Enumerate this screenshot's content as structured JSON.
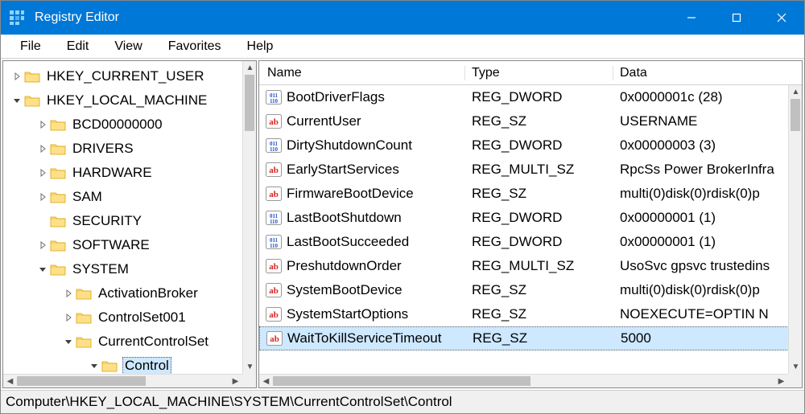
{
  "window": {
    "title": "Registry Editor"
  },
  "menu": {
    "items": [
      "File",
      "Edit",
      "View",
      "Favorites",
      "Help"
    ]
  },
  "tree": {
    "rows": [
      {
        "indent": 0,
        "expander": "closed",
        "label": "HKEY_CURRENT_USER",
        "selected": false
      },
      {
        "indent": 0,
        "expander": "open",
        "label": "HKEY_LOCAL_MACHINE",
        "selected": false
      },
      {
        "indent": 1,
        "expander": "closed",
        "label": "BCD00000000",
        "selected": false
      },
      {
        "indent": 1,
        "expander": "closed",
        "label": "DRIVERS",
        "selected": false
      },
      {
        "indent": 1,
        "expander": "closed",
        "label": "HARDWARE",
        "selected": false
      },
      {
        "indent": 1,
        "expander": "closed",
        "label": "SAM",
        "selected": false
      },
      {
        "indent": 1,
        "expander": "none",
        "label": "SECURITY",
        "selected": false
      },
      {
        "indent": 1,
        "expander": "closed",
        "label": "SOFTWARE",
        "selected": false
      },
      {
        "indent": 1,
        "expander": "open",
        "label": "SYSTEM",
        "selected": false
      },
      {
        "indent": 2,
        "expander": "closed",
        "label": "ActivationBroker",
        "selected": false
      },
      {
        "indent": 2,
        "expander": "closed",
        "label": "ControlSet001",
        "selected": false
      },
      {
        "indent": 2,
        "expander": "open",
        "label": "CurrentControlSet",
        "selected": false
      },
      {
        "indent": 3,
        "expander": "open",
        "label": "Control",
        "selected": true
      }
    ]
  },
  "list": {
    "headers": {
      "name": "Name",
      "type": "Type",
      "data": "Data"
    },
    "rows": [
      {
        "kind": "dword",
        "name": "BootDriverFlags",
        "type": "REG_DWORD",
        "data": "0x0000001c (28)",
        "selected": false
      },
      {
        "kind": "sz",
        "name": "CurrentUser",
        "type": "REG_SZ",
        "data": "USERNAME",
        "selected": false
      },
      {
        "kind": "dword",
        "name": "DirtyShutdownCount",
        "type": "REG_DWORD",
        "data": "0x00000003 (3)",
        "selected": false
      },
      {
        "kind": "sz",
        "name": "EarlyStartServices",
        "type": "REG_MULTI_SZ",
        "data": "RpcSs Power BrokerInfra",
        "selected": false
      },
      {
        "kind": "sz",
        "name": "FirmwareBootDevice",
        "type": "REG_SZ",
        "data": "multi(0)disk(0)rdisk(0)p",
        "selected": false
      },
      {
        "kind": "dword",
        "name": "LastBootShutdown",
        "type": "REG_DWORD",
        "data": "0x00000001 (1)",
        "selected": false
      },
      {
        "kind": "dword",
        "name": "LastBootSucceeded",
        "type": "REG_DWORD",
        "data": "0x00000001 (1)",
        "selected": false
      },
      {
        "kind": "sz",
        "name": "PreshutdownOrder",
        "type": "REG_MULTI_SZ",
        "data": "UsoSvc gpsvc trustedins",
        "selected": false
      },
      {
        "kind": "sz",
        "name": "SystemBootDevice",
        "type": "REG_SZ",
        "data": "multi(0)disk(0)rdisk(0)p",
        "selected": false
      },
      {
        "kind": "sz",
        "name": "SystemStartOptions",
        "type": "REG_SZ",
        "data": " NOEXECUTE=OPTIN  N",
        "selected": false
      },
      {
        "kind": "sz",
        "name": "WaitToKillServiceTimeout",
        "type": "REG_SZ",
        "data": "5000",
        "selected": true
      }
    ]
  },
  "statusbar": {
    "path": "Computer\\HKEY_LOCAL_MACHINE\\SYSTEM\\CurrentControlSet\\Control"
  },
  "colors": {
    "accent": "#0078d7",
    "selection": "#cde8ff"
  }
}
